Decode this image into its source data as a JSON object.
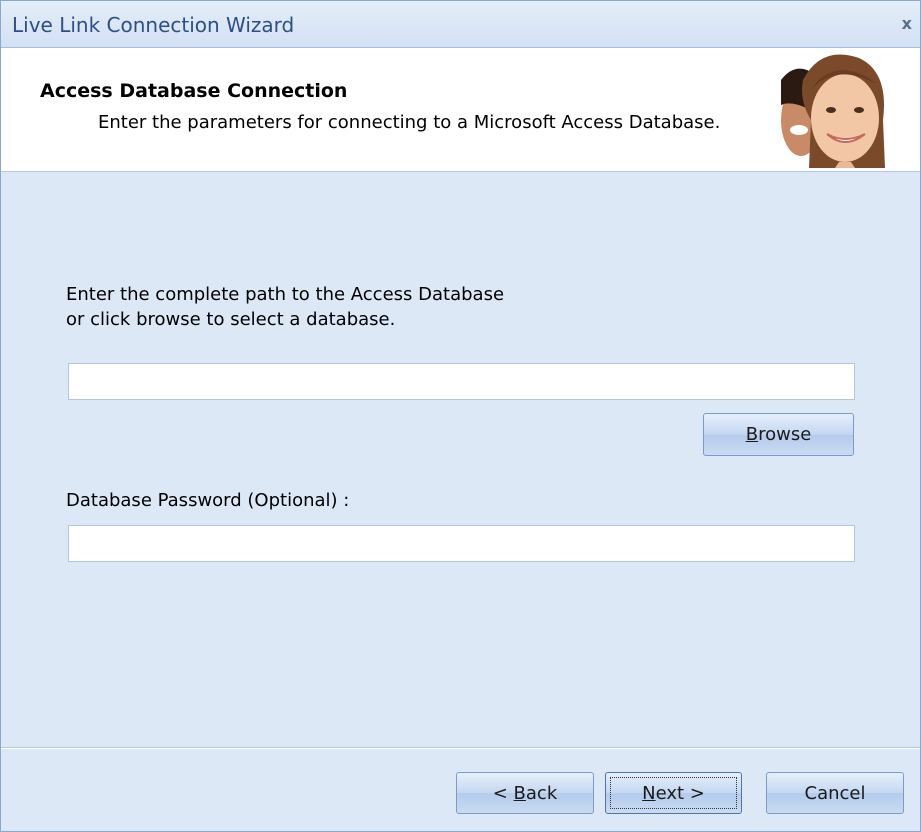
{
  "window": {
    "title": "Live Link Connection Wizard",
    "close_glyph": "x"
  },
  "header": {
    "title": "Access Database Connection",
    "subtitle": "Enter the parameters for connecting to a Microsoft Access Database.",
    "image": "people-photo"
  },
  "content": {
    "instruction_line1": "Enter the complete path to the Access Database",
    "instruction_line2": "or click browse to select a database.",
    "path_value": "",
    "browse_label_mnemonic": "B",
    "browse_label_rest": "rowse",
    "password_label": "Database Password (Optional) :",
    "password_value": ""
  },
  "footer": {
    "back_prefix": "< ",
    "back_mnemonic": "B",
    "back_rest": "ack",
    "next_mnemonic": "N",
    "next_rest": "ext >",
    "cancel_label": "Cancel"
  },
  "colors": {
    "background": "#dde8f7",
    "title_text": "#2c4f85",
    "button_border": "#7d9bc7"
  }
}
